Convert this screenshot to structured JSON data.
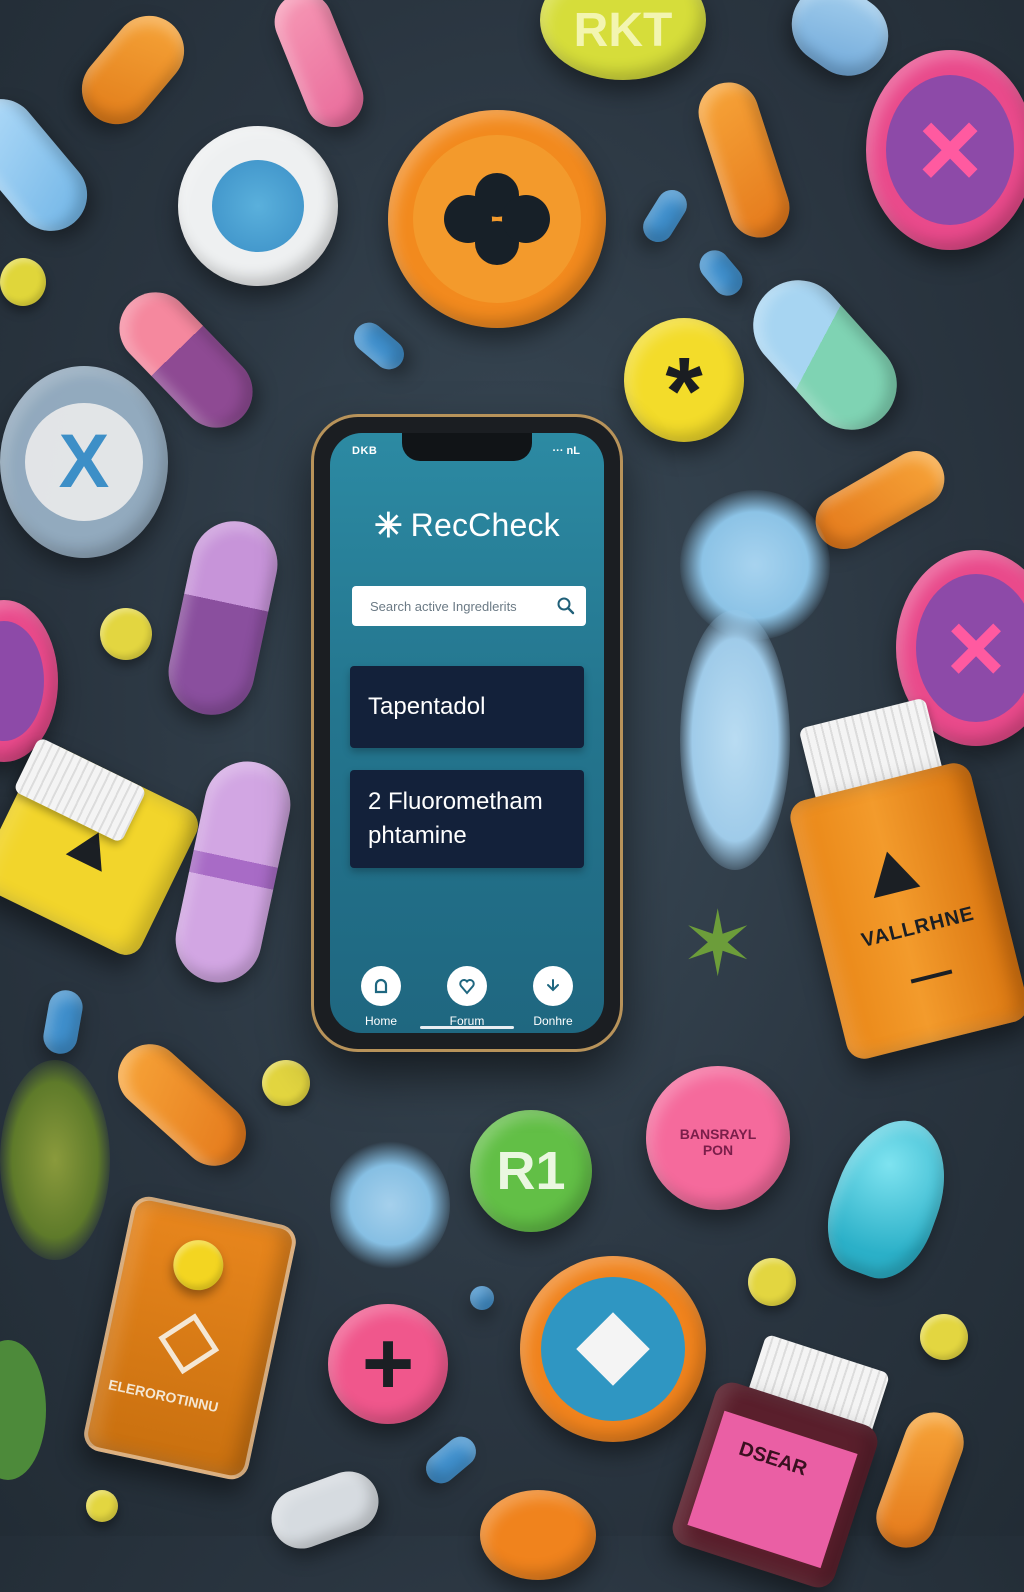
{
  "status_bar": {
    "left": "DKB",
    "right": "··· nL"
  },
  "app": {
    "icon": "asterisk-icon",
    "name": "RecCheck"
  },
  "search": {
    "placeholder": "Search active Ingredlerits"
  },
  "results": [
    {
      "label": "Tapentadol"
    },
    {
      "label": "2 Fluorometham phtamine"
    }
  ],
  "nav": [
    {
      "label": "Home",
      "icon": "home-icon"
    },
    {
      "label": "Forum",
      "icon": "heart-shield-icon"
    },
    {
      "label": "Donhre",
      "icon": "arrow-down-icon"
    }
  ],
  "background_labels": {
    "top_disc": "RKT",
    "bottle_orange": "VALLRHNE",
    "green_disc": "R1",
    "pink_disc_line1": "BANSRAYL",
    "pink_disc_line2": "PON",
    "orange_box": "ELEROROTINNU",
    "pink_bottle": "DSEAR"
  },
  "colors": {
    "app_bg": "#24768f",
    "result_bg": "#13213a",
    "background": "#2a3540"
  }
}
